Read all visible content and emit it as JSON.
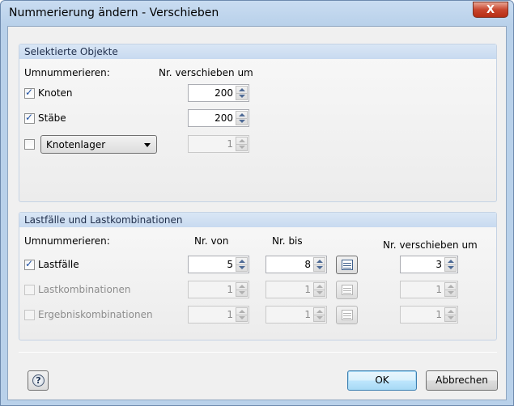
{
  "window": {
    "title": "Nummerierung ändern - Verschieben",
    "close_glyph": "X"
  },
  "selected": {
    "header": "Selektierte Objekte",
    "renumber_label": "Umnummerieren:",
    "shift_header": "Nr. verschieben  um",
    "rows": [
      {
        "label": "Knoten",
        "checked": true,
        "value": "200"
      },
      {
        "label": "Stäbe",
        "checked": true,
        "value": "200"
      },
      {
        "dropdown": "Knotenlager",
        "checked": false,
        "value": "1"
      }
    ]
  },
  "loads": {
    "header": "Lastfälle und Lastkombinationen",
    "renumber_label": "Umnummerieren:",
    "from_header": "Nr. von",
    "to_header": "Nr. bis",
    "shift_header": "Nr. verschieben  um",
    "rows": [
      {
        "label": "Lastfälle",
        "checked": true,
        "enabled": true,
        "from": "5",
        "to": "8",
        "shift": "3"
      },
      {
        "label": "Lastkombinationen",
        "checked": false,
        "enabled": false,
        "from": "1",
        "to": "1",
        "shift": "1"
      },
      {
        "label": "Ergebniskombinationen",
        "checked": false,
        "enabled": false,
        "from": "1",
        "to": "1",
        "shift": "1"
      }
    ]
  },
  "footer": {
    "ok_label": "OK",
    "cancel_label": "Abbrechen",
    "help_glyph": "?"
  },
  "colors": {
    "group_header": "#c8daf0",
    "accent": "#3c7fb1",
    "close": "#c8462e"
  }
}
